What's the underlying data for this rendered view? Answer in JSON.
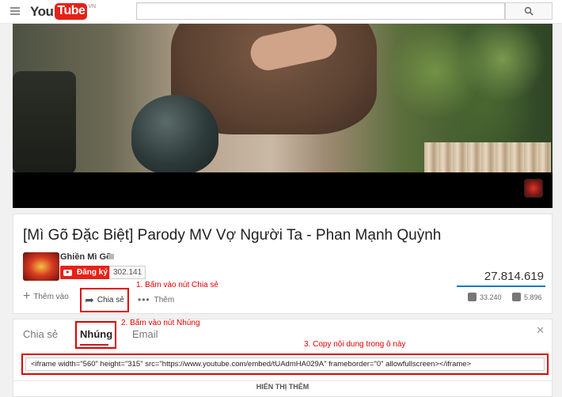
{
  "header": {
    "logo_you": "You",
    "logo_tube": "Tube",
    "logo_region": "VN",
    "search_placeholder": ""
  },
  "video": {
    "title": "[Mì Gõ Đặc Biệt] Parody MV Vợ Người Ta - Phan Mạnh Quỳnh",
    "channel_name": "Ghiền Mì Gõ",
    "subscribe_label": "Đăng ký",
    "subscriber_count": "302.141",
    "view_count": "27.814.619",
    "like_count": "33.240",
    "dislike_count": "5.896"
  },
  "actions": {
    "add_label": "Thêm vào",
    "share_label": "Chia sẻ",
    "more_label": "Thêm"
  },
  "share_panel": {
    "tabs": [
      "Chia sẻ",
      "Nhúng",
      "Email"
    ],
    "active_tab": "Nhúng",
    "embed_code": "<iframe width=\"560\" height=\"315\" src=\"https://www.youtube.com/embed/tUAdmHA029A\" frameborder=\"0\" allowfullscreen></iframe>",
    "show_more_label": "HIỂN THỊ THÊM"
  },
  "annotations": {
    "step1": "1. Bấm vào nút Chia sẻ",
    "step2": "2. Bấm vào nút Nhúng",
    "step3": "3. Copy nội dung trong ô này"
  },
  "colors": {
    "brand_red": "#e62117",
    "annotation_red": "#e00000",
    "link_blue": "#167ac6"
  }
}
